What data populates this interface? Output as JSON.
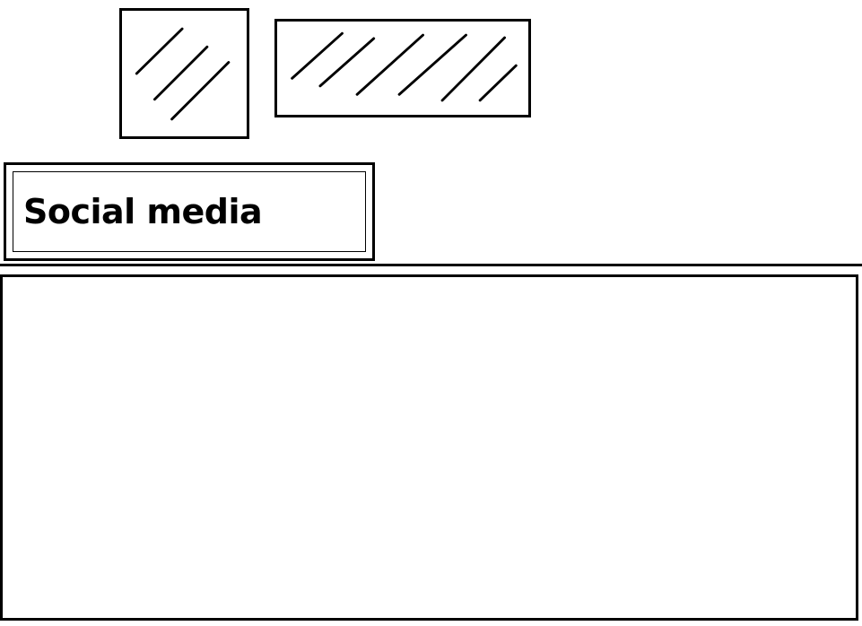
{
  "header": {
    "logo": {
      "icon": "image-placeholder-icon"
    },
    "banner": {
      "icon": "image-placeholder-icon"
    }
  },
  "social": {
    "label": "Social media"
  },
  "main": {
    "content": ""
  }
}
